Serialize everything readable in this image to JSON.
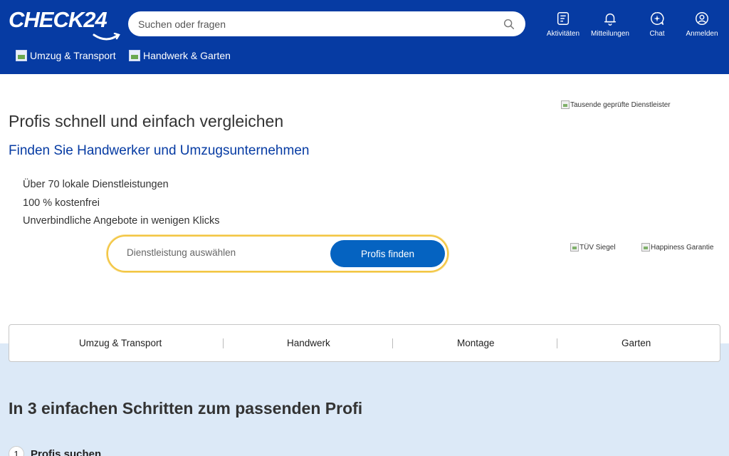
{
  "header": {
    "logo_text": "CHECK24",
    "search": {
      "placeholder": "Suchen oder fragen"
    },
    "actions": [
      {
        "label": "Aktivitäten",
        "icon": "activities-icon"
      },
      {
        "label": "Mitteilungen",
        "icon": "bell-icon"
      },
      {
        "label": "Chat",
        "icon": "chat-icon"
      },
      {
        "label": "Anmelden",
        "icon": "user-icon"
      }
    ],
    "subnav": [
      {
        "label": "Umzug & Transport"
      },
      {
        "label": "Handwerk & Garten"
      }
    ]
  },
  "hero": {
    "title": "Profis schnell und einfach vergleichen",
    "subtitle": "Finden Sie Handwerker und Umzugsunternehmen",
    "bullets": [
      "Über 70 lokale Dienstleistungen",
      "100 % kostenfrei",
      "Unverbindliche Angebote in wenigen Klicks"
    ],
    "service_placeholder": "Dienstleistung auswählen",
    "cta_label": "Profis finden",
    "badges": {
      "top": "Tausende geprüfte Dienstleister",
      "tuv": "TÜV Siegel",
      "happiness": "Happiness Garantie"
    }
  },
  "categories": [
    "Umzug & Transport",
    "Handwerk",
    "Montage",
    "Garten"
  ],
  "steps": {
    "heading": "In 3 einfachen Schritten zum passenden Profi",
    "items": [
      {
        "number": "1",
        "label": "Profis suchen"
      }
    ]
  },
  "colors": {
    "brand": "#063ba3",
    "cta": "#0563c1",
    "accent": "#f3c643",
    "section_bg": "#dce9f7"
  }
}
